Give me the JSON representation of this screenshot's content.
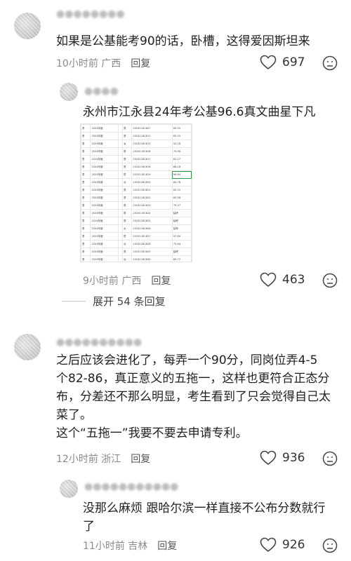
{
  "comments": [
    {
      "text": "如果是公基能考90的话，卧槽，这得爱因斯坦来",
      "time": "10小时前",
      "location": "广西",
      "reply_label": "回复",
      "likes": "697"
    },
    {
      "text": "永州市江永县24年考公基96.6真文曲星下凡",
      "time": "9小时前",
      "location": "广西",
      "reply_label": "回复",
      "likes": "463",
      "expand_label": "展开 54 条回复"
    },
    {
      "text_lines": [
        "之后应该会进化了，每弄一个90分，同岗位弄4-5",
        "个82-86，真正意义的五拖一，这样也更符合正态分",
        "布，分差还不那么明显，考生看到了只会觉得自己太",
        "菜了。",
        "这个“五拖一”我要不要去申请专利。"
      ],
      "time": "12小时前",
      "location": "浙江",
      "reply_label": "回复",
      "likes": "936"
    },
    {
      "text_lines": [
        "没那么麻烦 跟哈尔滨一样直接不公布分数就行",
        "了"
      ],
      "time": "11小时前",
      "location": "吉林",
      "reply_label": "回复",
      "likes": "926"
    }
  ],
  "sheet": {
    "rows": [
      [
        "男",
        "2024年度",
        "",
        "男",
        "20241181807",
        "85.95"
      ],
      [
        "男",
        "2024年度",
        "",
        "男",
        "20241181811",
        "65.55"
      ],
      [
        "男",
        "2024年度",
        "",
        "女",
        "20241181815",
        "54.18"
      ],
      [
        "男",
        "2024年度",
        "",
        "男",
        "20241181816",
        "75.98"
      ],
      [
        "男",
        "2024年度",
        "",
        "男",
        "20241181817",
        "81.27"
      ],
      [
        "男",
        "2024年度",
        "",
        "男",
        "20241181818",
        "88.18"
      ],
      [
        "男",
        "2024年度",
        "",
        "男",
        "20241181819",
        "96.64"
      ],
      [
        "男",
        "2024年度",
        "",
        "女",
        "20241181820",
        "84.78"
      ],
      [
        "男",
        "2024年度",
        "",
        "男",
        "20241181821",
        "85.55"
      ],
      [
        "男",
        "2024年度",
        "",
        "男",
        "20241181822",
        "83.56"
      ],
      [
        "男",
        "2024年度",
        "",
        "男",
        "20241181823",
        "70.27"
      ],
      [
        "男",
        "2024年度",
        "",
        "男",
        "20241181824",
        "缺考"
      ],
      [
        "男",
        "2024年度",
        "",
        "男",
        "20241181825",
        "缺考"
      ],
      [
        "男",
        "2024年度",
        "",
        "女",
        "20241181826",
        "缺考"
      ],
      [
        "男",
        "2024年度",
        "",
        "男",
        "20241181827",
        "97.89"
      ],
      [
        "男",
        "2024年度",
        "",
        "女",
        "20241181828",
        "73.64"
      ],
      [
        "男",
        "2024年度",
        "",
        "男",
        "20241181829",
        "缺考"
      ],
      [
        "男",
        "2024年度",
        "",
        "女",
        "20241181830",
        "85.72"
      ]
    ]
  }
}
